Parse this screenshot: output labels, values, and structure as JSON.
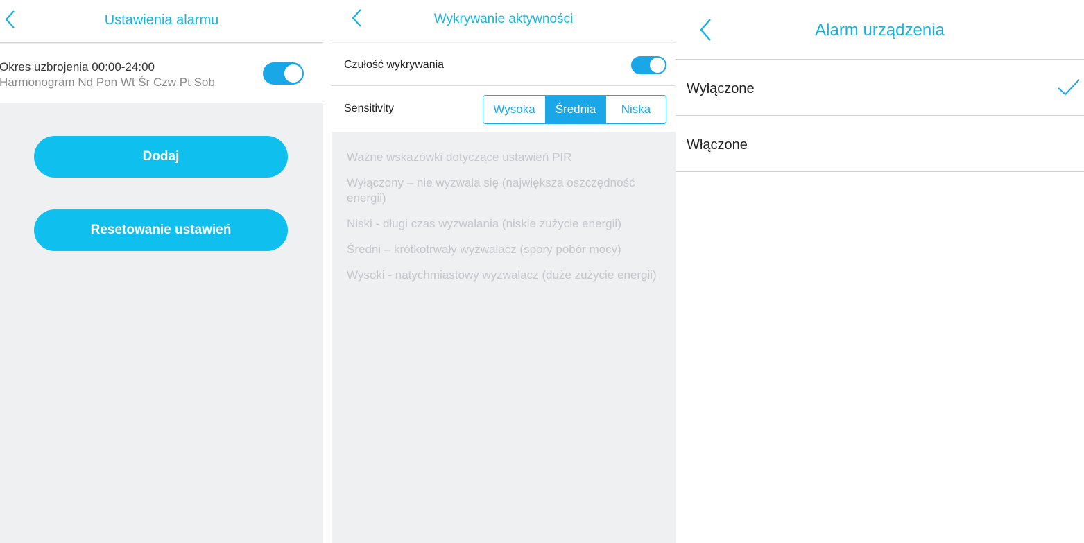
{
  "panel1": {
    "title": "Ustawienia alarmu",
    "period_label": "Okres uzbrojenia",
    "period_value": "00:00-24:00",
    "schedule_label": "Harmonogram",
    "schedule_days": "Nd Pon Wt Śr Czw Pt Sob",
    "armed_toggle_on": true,
    "add_button": "Dodaj",
    "reset_button": "Resetowanie ustawień"
  },
  "panel2": {
    "title": "Wykrywanie aktywności",
    "detection_label": "Czułość wykrywania",
    "detection_toggle_on": true,
    "sensitivity_label": "Sensitivity",
    "sensitivity_options": [
      "Wysoka",
      "Średnia",
      "Niska"
    ],
    "sensitivity_selected": "Średnia",
    "tips": [
      "Ważne wskazówki dotyczące ustawień PIR",
      "Wyłączony – nie wyzwala się (największa oszczędność energii)",
      "Niski - długi czas wyzwalania (niskie zużycie energii)",
      "Średni – krótkotrwały wyzwalacz (spory pobór mocy)",
      "Wysoki - natychmiastowy wyzwalacz (duże zużycie energii)"
    ]
  },
  "panel3": {
    "title": "Alarm urządzenia",
    "options": [
      "Wyłączone",
      "Włączone"
    ],
    "selected": "Wyłączone"
  },
  "colors": {
    "accent": "#1aa7e8",
    "title": "#14b4e0",
    "button": "#0fc0ee",
    "background": "#eff0f2",
    "hint_text": "#c3c6cb"
  },
  "icons": {
    "back": "chevron-left-icon",
    "check": "check-icon"
  }
}
